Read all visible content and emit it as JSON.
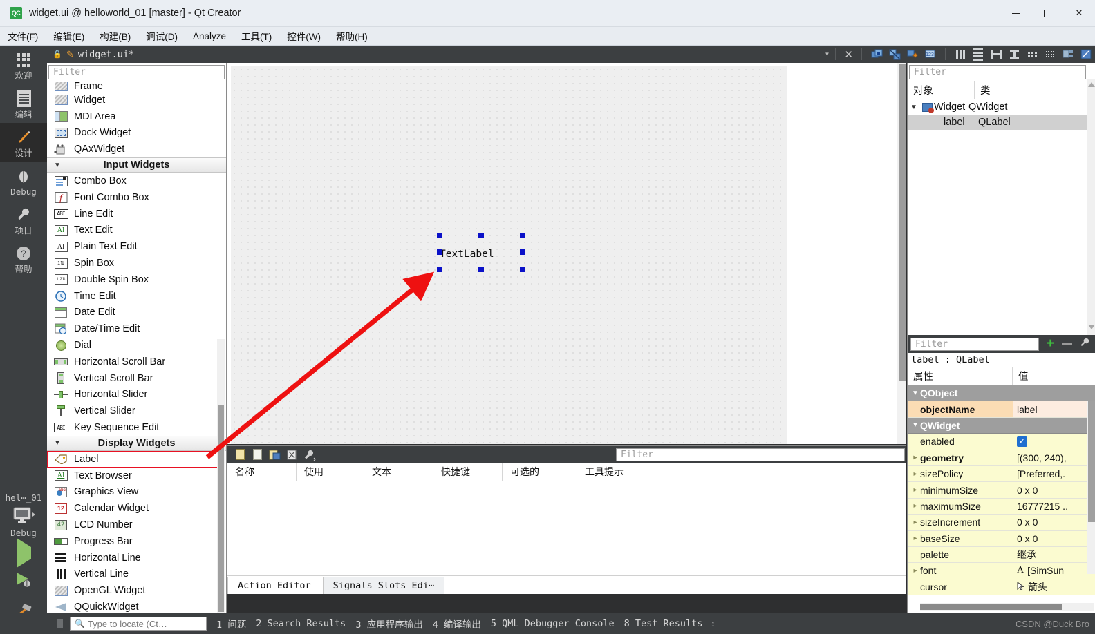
{
  "window": {
    "title": "widget.ui @ helloworld_01 [master] - Qt Creator",
    "app_icon": "QC",
    "minimize": "—",
    "maximize": "□",
    "close": "✕"
  },
  "menubar": {
    "items": [
      {
        "label": "文件(F)",
        "name": "menu-file"
      },
      {
        "label": "编辑(E)",
        "name": "menu-edit"
      },
      {
        "label": "构建(B)",
        "name": "menu-build"
      },
      {
        "label": "调试(D)",
        "name": "menu-debug"
      },
      {
        "label": "Analyze",
        "name": "menu-analyze"
      },
      {
        "label": "工具(T)",
        "name": "menu-tools"
      },
      {
        "label": "控件(W)",
        "name": "menu-widgets"
      },
      {
        "label": "帮助(H)",
        "name": "menu-help"
      }
    ]
  },
  "modebar": {
    "items": [
      {
        "label": "欢迎",
        "icon": "grid-icon",
        "active": false
      },
      {
        "label": "编辑",
        "icon": "document-icon",
        "active": false
      },
      {
        "label": "设计",
        "icon": "pencil-icon",
        "active": true
      },
      {
        "label": "Debug",
        "icon": "bug-icon",
        "active": false
      },
      {
        "label": "项目",
        "icon": "wrench-icon",
        "active": false
      },
      {
        "label": "帮助",
        "icon": "question-icon",
        "active": false
      }
    ],
    "kit": {
      "project": "hel⋯_01",
      "build_config": "Debug",
      "monitor_icon": "monitor-icon"
    },
    "run_buttons": [
      {
        "name": "run-button",
        "icon": "play-icon"
      },
      {
        "name": "debug-button",
        "icon": "play-bug-icon"
      },
      {
        "name": "build-button",
        "icon": "hammer-icon"
      }
    ]
  },
  "filebar": {
    "lock_icon": "lock-icon",
    "file_icon": "pencil-file-icon",
    "filename": "widget.ui*",
    "dropdown_icon": "chevron-down-icon",
    "close_icon": "close-icon",
    "tools": [
      "edit-widgets-icon",
      "edit-signals-icon",
      "edit-buddies-icon",
      "edit-tab-order-icon",
      "layout-horizontally-icon",
      "layout-vertically-icon",
      "layout-splitter-h-icon",
      "layout-splitter-v-icon",
      "layout-form-icon",
      "layout-grid-icon",
      "break-layout-icon",
      "adjust-size-icon"
    ]
  },
  "widget_box": {
    "filter_placeholder": "Filter",
    "groups": [
      {
        "section": null,
        "items": [
          {
            "label": "Frame",
            "icon": "frame-icon",
            "partial": true
          },
          {
            "label": "Widget",
            "icon": "widget-icon"
          },
          {
            "label": "MDI Area",
            "icon": "mdi-area-icon"
          },
          {
            "label": "Dock Widget",
            "icon": "dock-widget-icon"
          },
          {
            "label": "QAxWidget",
            "icon": "qax-widget-icon"
          }
        ]
      },
      {
        "section": "Input Widgets",
        "items": [
          {
            "label": "Combo Box",
            "icon": "combo-box-icon"
          },
          {
            "label": "Font Combo Box",
            "icon": "font-combo-box-icon"
          },
          {
            "label": "Line Edit",
            "icon": "line-edit-icon"
          },
          {
            "label": "Text Edit",
            "icon": "text-edit-icon"
          },
          {
            "label": "Plain Text Edit",
            "icon": "plain-text-edit-icon"
          },
          {
            "label": "Spin Box",
            "icon": "spin-box-icon"
          },
          {
            "label": "Double Spin Box",
            "icon": "double-spin-box-icon"
          },
          {
            "label": "Time Edit",
            "icon": "time-edit-icon"
          },
          {
            "label": "Date Edit",
            "icon": "date-edit-icon"
          },
          {
            "label": "Date/Time Edit",
            "icon": "date-time-edit-icon"
          },
          {
            "label": "Dial",
            "icon": "dial-icon"
          },
          {
            "label": "Horizontal Scroll Bar",
            "icon": "horizontal-scroll-bar-icon"
          },
          {
            "label": "Vertical Scroll Bar",
            "icon": "vertical-scroll-bar-icon"
          },
          {
            "label": "Horizontal Slider",
            "icon": "horizontal-slider-icon"
          },
          {
            "label": "Vertical Slider",
            "icon": "vertical-slider-icon"
          },
          {
            "label": "Key Sequence Edit",
            "icon": "key-sequence-edit-icon"
          }
        ]
      },
      {
        "section": "Display Widgets",
        "items": [
          {
            "label": "Label",
            "icon": "label-icon",
            "highlighted": true
          },
          {
            "label": "Text Browser",
            "icon": "text-browser-icon"
          },
          {
            "label": "Graphics View",
            "icon": "graphics-view-icon"
          },
          {
            "label": "Calendar Widget",
            "icon": "calendar-widget-icon"
          },
          {
            "label": "LCD Number",
            "icon": "lcd-number-icon"
          },
          {
            "label": "Progress Bar",
            "icon": "progress-bar-icon"
          },
          {
            "label": "Horizontal Line",
            "icon": "horizontal-line-icon"
          },
          {
            "label": "Vertical Line",
            "icon": "vertical-line-icon"
          },
          {
            "label": "OpenGL Widget",
            "icon": "opengl-widget-icon"
          },
          {
            "label": "QQuickWidget",
            "icon": "qquick-widget-icon"
          }
        ]
      }
    ]
  },
  "form": {
    "selected_widget_text": "TextLabel",
    "selection_handle_color": "#0b11c8"
  },
  "action_editor": {
    "toolbar_icons": [
      "new-action-icon",
      "copy-action-icon",
      "paste-action-icon",
      "delete-action-icon",
      "configure-icon"
    ],
    "filter_placeholder": "Filter",
    "columns": [
      "名称",
      "使用",
      "文本",
      "快捷键",
      "可选的",
      "工具提示"
    ],
    "rows": [],
    "tabs": [
      {
        "label": "Action Editor",
        "selected": true
      },
      {
        "label": "Signals  Slots Edi⋯",
        "selected": false
      }
    ]
  },
  "object_inspector": {
    "filter_placeholder": "Filter",
    "columns": [
      "对象",
      "类"
    ],
    "rows": [
      {
        "name": "Widget",
        "class": "QWidget",
        "indent": 0,
        "expanded": true,
        "icon": "widget-tree-icon",
        "selected": false
      },
      {
        "name": "label",
        "class": "QLabel",
        "indent": 1,
        "expanded": null,
        "icon": null,
        "selected": true
      }
    ]
  },
  "property_editor": {
    "filter_placeholder": "Filter",
    "add_icon": "plus-icon",
    "remove_icon": "minus-icon",
    "configure_icon": "wrench-icon",
    "target": "label : QLabel",
    "columns": [
      "属性",
      "值"
    ],
    "rows": [
      {
        "key": "QObject",
        "value": "",
        "type": "group",
        "expanded": true
      },
      {
        "key": "objectName",
        "value": "label",
        "type": "orange",
        "expandable": false
      },
      {
        "key": "QWidget",
        "value": "",
        "type": "group",
        "expanded": true
      },
      {
        "key": "enabled",
        "value": "",
        "type": "check",
        "checked": true,
        "expandable": false
      },
      {
        "key": "geometry",
        "value": "[(300, 240),",
        "type": "yellow",
        "expandable": true,
        "bold": true
      },
      {
        "key": "sizePolicy",
        "value": "[Preferred,.",
        "type": "yellow",
        "expandable": true
      },
      {
        "key": "minimumSize",
        "value": "0 x 0",
        "type": "yellow",
        "expandable": true
      },
      {
        "key": "maximumSize",
        "value": "16777215 ..",
        "type": "yellow",
        "expandable": true
      },
      {
        "key": "sizeIncrement",
        "value": "0 x 0",
        "type": "yellow",
        "expandable": true
      },
      {
        "key": "baseSize",
        "value": "0 x 0",
        "type": "yellow",
        "expandable": true
      },
      {
        "key": "palette",
        "value": "继承",
        "type": "yellow",
        "expandable": false
      },
      {
        "key": "font",
        "value": "[SimSun",
        "type": "yellow",
        "expandable": true,
        "icon": "font-icon"
      },
      {
        "key": "cursor",
        "value": "箭头",
        "type": "yellow",
        "expandable": false,
        "icon": "cursor-arrow-icon"
      }
    ]
  },
  "statusbar": {
    "locate_placeholder": "Type to locate (Ct…",
    "search_icon": "search-icon",
    "panels": [
      "1 问题",
      "2 Search Results",
      "3 应用程序输出",
      "4 编译输出",
      "5 QML Debugger Console",
      "8 Test Results"
    ],
    "updown_icon": "up-down-icon",
    "watermark": "CSDN @Duck Bro"
  },
  "annotation": {
    "arrow_color": "#ee1111",
    "highlight_color": "#e81123"
  }
}
